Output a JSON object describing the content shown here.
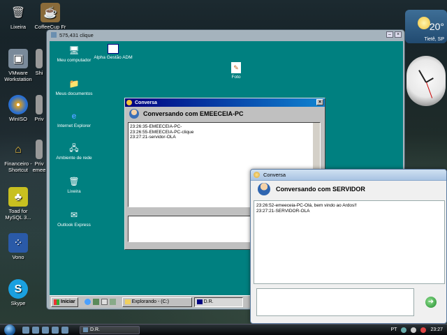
{
  "host_desktop": {
    "icons": [
      {
        "label": "Lixeira",
        "icon": "recycle-bin-icon"
      },
      {
        "label": "CoffeeCup Fr",
        "icon": "coffee-icon"
      },
      {
        "label": "VMware Workstation",
        "icon": "vmware-icon"
      },
      {
        "label": "WinISO",
        "icon": "disc-icon"
      },
      {
        "label": "Financeiro - Shortcut",
        "icon": "house-icon"
      },
      {
        "label": "Toad for MySQL 3...",
        "icon": "toad-icon"
      },
      {
        "label": "Vono",
        "icon": "vono-icon"
      },
      {
        "label": "Skype",
        "icon": "skype-icon"
      },
      {
        "label": "Shi",
        "icon": "app-icon"
      },
      {
        "label": "Priv",
        "icon": "app-icon"
      },
      {
        "label": "Priv emee",
        "icon": "app-icon"
      }
    ],
    "weather": {
      "temp": "20°",
      "city": "Tietê, SP"
    },
    "taskbar": {
      "task_label": "D.R.",
      "lang": "PT",
      "time": "23:27"
    }
  },
  "vm_window": {
    "title": "575,431 clique"
  },
  "guest_desktop": {
    "icons": [
      {
        "label": "Meu computador",
        "icon": "computer-icon"
      },
      {
        "label": "Alpha Gestão ADM",
        "icon": "window-icon"
      },
      {
        "label": "Foto",
        "icon": "photo-icon"
      },
      {
        "label": "Meus documentos",
        "icon": "folder-icon"
      },
      {
        "label": "Internet Explorer",
        "icon": "ie-icon"
      },
      {
        "label": "Ambiente de rede",
        "icon": "network-icon"
      },
      {
        "label": "Lixeira",
        "icon": "recycle-bin-icon"
      },
      {
        "label": "Outlook Express",
        "icon": "outlook-icon"
      }
    ],
    "taskbar": {
      "start_label": "Iniciar",
      "task1": "Explorando - (C:)",
      "task2": "D.R."
    }
  },
  "conversa1": {
    "title": "Conversa",
    "header": "Conversando com EMEECEIA-PC",
    "log": [
      "23:26:35-EMEECEIA-PC-",
      "23:26:55-EMEECEIA-PC-clique",
      "23:27:21-servidor-OLA"
    ]
  },
  "conversa2": {
    "title": "Conversa",
    "header": "Conversando com SERVIDOR",
    "log": [
      "23:26:52-emeeceia-PC-Olá, bem vindo ao Ardos!!",
      "23:27:21-SERVIDOR-OLA"
    ]
  }
}
